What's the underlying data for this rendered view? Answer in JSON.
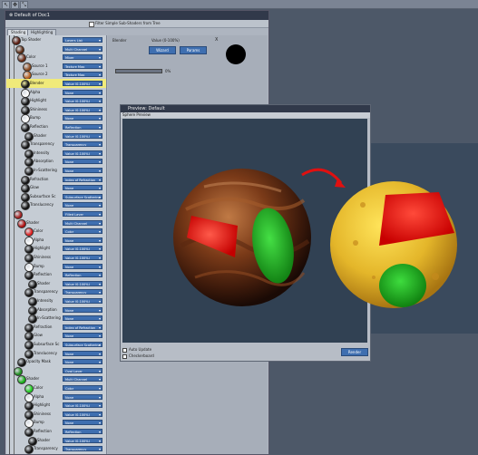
{
  "window": {
    "title": "Default of Doc1",
    "filter_label": "Filter Simple Sub-Shaders from Tree",
    "tabs": [
      "Shading",
      "Highlighting"
    ]
  },
  "tree": [
    {
      "label": "Top Shader",
      "value": "Layers List",
      "color": "#5a1c10"
    },
    {
      "label": "",
      "value": "Multi Channel",
      "color": "#5a2a12"
    },
    {
      "label": "Color",
      "value": "Mixer",
      "color": "#6a2a14"
    },
    {
      "label": "Source 1",
      "value": "Texture Map",
      "color": "#8c4a20"
    },
    {
      "label": "Source 2",
      "value": "Texture Map",
      "color": "#b8601f"
    },
    {
      "label": "Blender",
      "value": "Value (0-100%)",
      "color": "#111111",
      "highlight": true
    },
    {
      "label": "Alpha",
      "value": "None",
      "color": "#fefefe"
    },
    {
      "label": "Highlight",
      "value": "Value (0-100%)",
      "color": "#111111"
    },
    {
      "label": "Shininess",
      "value": "Value (0-100%)",
      "color": "#111111"
    },
    {
      "label": "Bump",
      "value": "None",
      "color": "#fefefe"
    },
    {
      "label": "Reflection",
      "value": "Reflection",
      "color": "#111111"
    },
    {
      "label": "Shader",
      "value": "Value (0-100%)",
      "color": "#111111"
    },
    {
      "label": "Transparency",
      "value": "Transparency",
      "color": "#111111"
    },
    {
      "label": "Intensity",
      "value": "Value (0-100%)",
      "color": "#111111"
    },
    {
      "label": "Absorption",
      "value": "None",
      "color": "#111111"
    },
    {
      "label": "In-Scattering",
      "value": "None",
      "color": "#111111"
    },
    {
      "label": "Refraction",
      "value": "Index of Refraction",
      "color": "#111111"
    },
    {
      "label": "Glow",
      "value": "None",
      "color": "#111111"
    },
    {
      "label": "Subsurface Sc",
      "value": "Subsurface Scattering",
      "color": "#111111"
    },
    {
      "label": "Translucency",
      "value": "None",
      "color": "#111111"
    },
    {
      "label": "",
      "value": "Filled Layer",
      "color": "#a02020"
    },
    {
      "label": "Shader",
      "value": "Multi Channel",
      "color": "#b01010"
    },
    {
      "label": "Color",
      "value": "Color",
      "color": "#e02020"
    },
    {
      "label": "Alpha",
      "value": "None",
      "color": "#fefefe"
    },
    {
      "label": "Highlight",
      "value": "Value (0-100%)",
      "color": "#111111"
    },
    {
      "label": "Shininess",
      "value": "Value (0-100%)",
      "color": "#111111"
    },
    {
      "label": "Bump",
      "value": "None",
      "color": "#fefefe"
    },
    {
      "label": "Reflection",
      "value": "Reflection",
      "color": "#111111"
    },
    {
      "label": "Shader",
      "value": "Value (0-100%)",
      "color": "#111111"
    },
    {
      "label": "Transparency",
      "value": "Transparency",
      "color": "#111111"
    },
    {
      "label": "Intensity",
      "value": "Value (0-100%)",
      "color": "#111111"
    },
    {
      "label": "Absorption",
      "value": "None",
      "color": "#111111"
    },
    {
      "label": "In-Scattering",
      "value": "None",
      "color": "#111111"
    },
    {
      "label": "Refraction",
      "value": "Index of Refraction",
      "color": "#111111"
    },
    {
      "label": "Glow",
      "value": "None",
      "color": "#111111"
    },
    {
      "label": "Subsurface Sc",
      "value": "Subsurface Scattering",
      "color": "#111111"
    },
    {
      "label": "Translucency",
      "value": "None",
      "color": "#111111"
    },
    {
      "label": "Opacity Mask",
      "value": "None",
      "color": "#111111"
    },
    {
      "label": "",
      "value": "Oval Layer",
      "color": "#1f8f1f"
    },
    {
      "label": "Shader",
      "value": "Multi Channel",
      "color": "#19b019"
    },
    {
      "label": "Color",
      "value": "Color",
      "color": "#22d022"
    },
    {
      "label": "Alpha",
      "value": "None",
      "color": "#fefefe"
    },
    {
      "label": "Highlight",
      "value": "Value (0-100%)",
      "color": "#111111"
    },
    {
      "label": "Shininess",
      "value": "Value (0-100%)",
      "color": "#111111"
    },
    {
      "label": "Bump",
      "value": "None",
      "color": "#fefefe"
    },
    {
      "label": "Reflection",
      "value": "Reflection",
      "color": "#111111"
    },
    {
      "label": "Shader",
      "value": "Value (0-100%)",
      "color": "#111111"
    },
    {
      "label": "Transparency",
      "value": "Transparency",
      "color": "#111111"
    }
  ],
  "props": {
    "label": "Blender",
    "value_text": "Value (0-100%)",
    "wizard_label": "Wizard",
    "params_label": "Params",
    "close_label": "X",
    "slider_value": "0%",
    "swatch_color": "#000000"
  },
  "preview": {
    "title": "Preview: Default",
    "subtitle": "Sphere Preview",
    "auto_update_label": "Auto Update",
    "checkerboard_label": "Checkerboard",
    "render_label": "Render"
  }
}
